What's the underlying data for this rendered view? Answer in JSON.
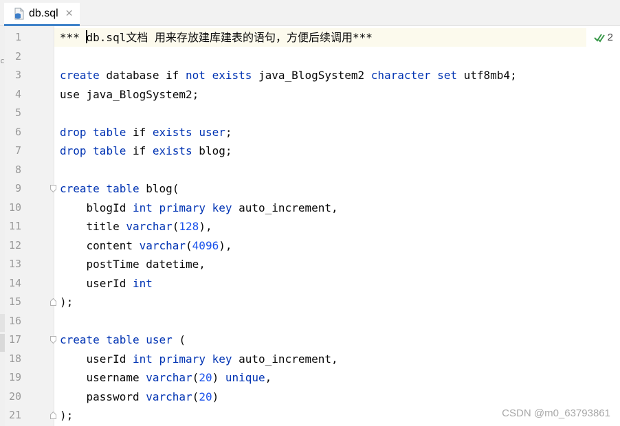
{
  "tab": {
    "title": "db.sql",
    "close": "✕"
  },
  "left_strip": {
    "letter": "c"
  },
  "inspection": {
    "count": "2",
    "icon": "check-double-icon"
  },
  "watermark": "CSDN @m0_63793861",
  "colors": {
    "keyword": "#0033b3",
    "number": "#1750eb",
    "text": "#080808",
    "line_number": "#999999",
    "tab_accent": "#4083c9",
    "caret_line": "#fcfaed"
  },
  "lines": [
    {
      "n": "1",
      "fold": false,
      "segs": [
        {
          "t": "*** "
        },
        {
          "t": "db.sql文档 用来存放建库建表的语句，方便后续调用***"
        }
      ]
    },
    {
      "n": "2",
      "fold": false,
      "segs": []
    },
    {
      "n": "3",
      "fold": false,
      "segs": [
        {
          "t": "create",
          "k": "kw"
        },
        {
          "t": " database if "
        },
        {
          "t": "not",
          "k": "kw"
        },
        {
          "t": " "
        },
        {
          "t": "exists",
          "k": "kw"
        },
        {
          "t": " java_BlogSystem2 "
        },
        {
          "t": "character set",
          "k": "kw"
        },
        {
          "t": " utf8mb4;"
        }
      ]
    },
    {
      "n": "4",
      "fold": false,
      "segs": [
        {
          "t": "use java_BlogSystem2;"
        }
      ]
    },
    {
      "n": "5",
      "fold": false,
      "segs": []
    },
    {
      "n": "6",
      "fold": false,
      "segs": [
        {
          "t": "drop",
          "k": "kw"
        },
        {
          "t": " "
        },
        {
          "t": "table",
          "k": "kw"
        },
        {
          "t": " if "
        },
        {
          "t": "exists",
          "k": "kw"
        },
        {
          "t": " "
        },
        {
          "t": "user",
          "k": "kw"
        },
        {
          "t": ";"
        }
      ]
    },
    {
      "n": "7",
      "fold": false,
      "segs": [
        {
          "t": "drop",
          "k": "kw"
        },
        {
          "t": " "
        },
        {
          "t": "table",
          "k": "kw"
        },
        {
          "t": " if "
        },
        {
          "t": "exists",
          "k": "kw"
        },
        {
          "t": " blog;"
        }
      ]
    },
    {
      "n": "8",
      "fold": false,
      "segs": []
    },
    {
      "n": "9",
      "fold": "open",
      "segs": [
        {
          "t": "create",
          "k": "kw"
        },
        {
          "t": " "
        },
        {
          "t": "table",
          "k": "kw"
        },
        {
          "t": " blog("
        }
      ]
    },
    {
      "n": "10",
      "fold": false,
      "segs": [
        {
          "t": "    blogId "
        },
        {
          "t": "int",
          "k": "kw"
        },
        {
          "t": " "
        },
        {
          "t": "primary key",
          "k": "kw"
        },
        {
          "t": " auto_increment,"
        }
      ]
    },
    {
      "n": "11",
      "fold": false,
      "segs": [
        {
          "t": "    title "
        },
        {
          "t": "varchar",
          "k": "kw"
        },
        {
          "t": "("
        },
        {
          "t": "128",
          "k": "num"
        },
        {
          "t": "),"
        }
      ]
    },
    {
      "n": "12",
      "fold": false,
      "segs": [
        {
          "t": "    content "
        },
        {
          "t": "varchar",
          "k": "kw"
        },
        {
          "t": "("
        },
        {
          "t": "4096",
          "k": "num"
        },
        {
          "t": "),"
        }
      ]
    },
    {
      "n": "13",
      "fold": false,
      "segs": [
        {
          "t": "    postTime datetime,"
        }
      ]
    },
    {
      "n": "14",
      "fold": false,
      "segs": [
        {
          "t": "    userId "
        },
        {
          "t": "int",
          "k": "kw"
        }
      ]
    },
    {
      "n": "15",
      "fold": "close",
      "segs": [
        {
          "t": ");"
        }
      ]
    },
    {
      "n": "16",
      "fold": false,
      "segs": []
    },
    {
      "n": "17",
      "fold": "open",
      "segs": [
        {
          "t": "create",
          "k": "kw"
        },
        {
          "t": " "
        },
        {
          "t": "table",
          "k": "kw"
        },
        {
          "t": " "
        },
        {
          "t": "user",
          "k": "kw"
        },
        {
          "t": " ("
        }
      ]
    },
    {
      "n": "18",
      "fold": false,
      "segs": [
        {
          "t": "    userId "
        },
        {
          "t": "int",
          "k": "kw"
        },
        {
          "t": " "
        },
        {
          "t": "primary key",
          "k": "kw"
        },
        {
          "t": " auto_increment,"
        }
      ]
    },
    {
      "n": "19",
      "fold": false,
      "segs": [
        {
          "t": "    username "
        },
        {
          "t": "varchar",
          "k": "kw"
        },
        {
          "t": "("
        },
        {
          "t": "20",
          "k": "num"
        },
        {
          "t": ") "
        },
        {
          "t": "unique",
          "k": "kw"
        },
        {
          "t": ","
        }
      ]
    },
    {
      "n": "20",
      "fold": false,
      "segs": [
        {
          "t": "    password "
        },
        {
          "t": "varchar",
          "k": "kw"
        },
        {
          "t": "("
        },
        {
          "t": "20",
          "k": "num"
        },
        {
          "t": ")"
        }
      ]
    },
    {
      "n": "21",
      "fold": "close",
      "segs": [
        {
          "t": ");"
        }
      ]
    }
  ]
}
